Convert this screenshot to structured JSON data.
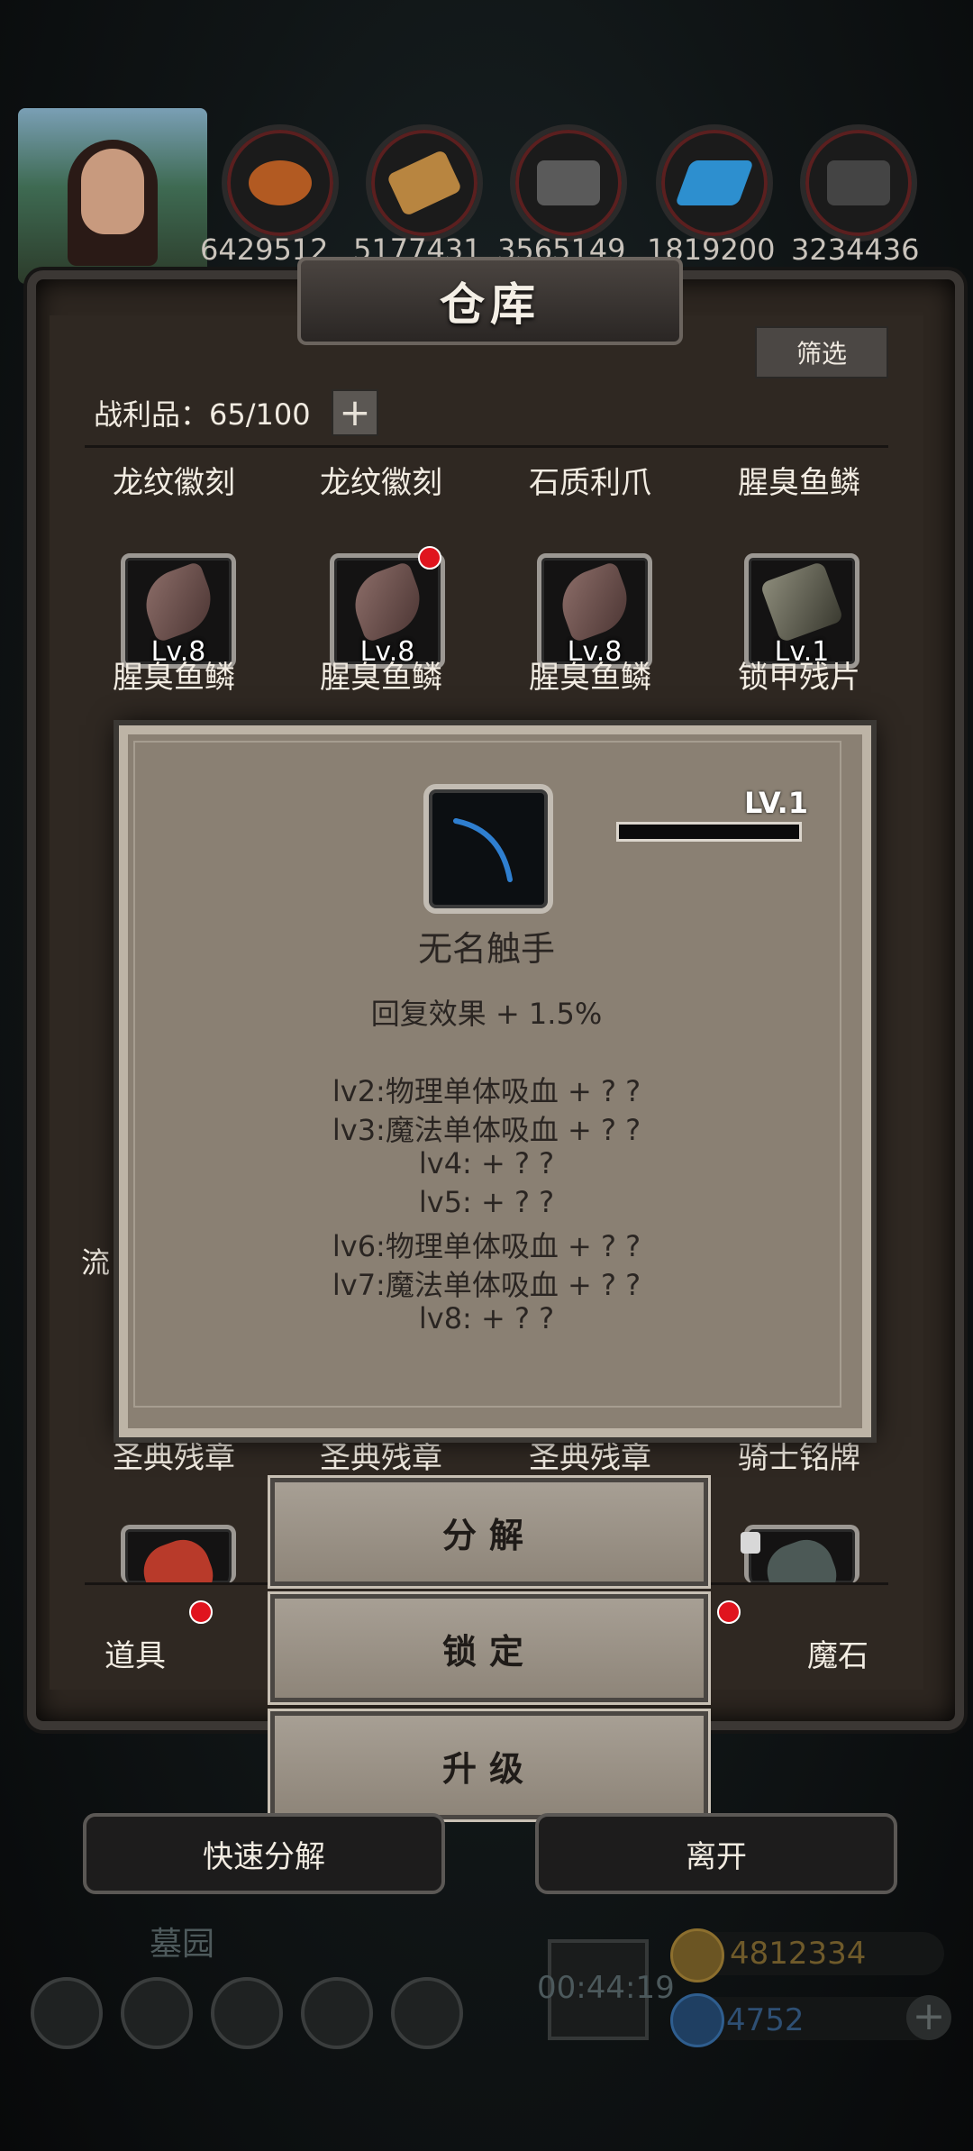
{
  "hud": {
    "resources": [
      "6429512",
      "5177431",
      "3565149",
      "1819200",
      "3234436"
    ],
    "resource_icons": [
      "ore-icon",
      "wood-icon",
      "iron-icon",
      "crystal-icon",
      "steel-icon"
    ]
  },
  "warehouse": {
    "title": "仓库",
    "filter_label": "筛选",
    "loot_count": "战利品：65/100",
    "add_label": "+",
    "row1_labels": [
      "龙纹徽刻",
      "龙纹徽刻",
      "石质利爪",
      "腥臭鱼鳞"
    ],
    "row2": [
      {
        "level": "Lv.8",
        "name": "腥臭鱼鳞"
      },
      {
        "level": "Lv.8",
        "name": "腥臭鱼鳞"
      },
      {
        "level": "Lv.8",
        "name": "腥臭鱼鳞"
      },
      {
        "level": "Lv.1",
        "name": "锁甲残片"
      }
    ],
    "partial_left_label": "流",
    "row_bottom_labels": [
      "圣典残章",
      "圣典残章",
      "圣典残章",
      "骑士铭牌"
    ]
  },
  "popup": {
    "level": "LV.1",
    "level_progress": 0.0,
    "name": "无名触手",
    "effect": "回复效果 + 1.5%",
    "lines": [
      "lv2:物理单体吸血 + ? ?",
      "lv3:魔法单体吸血 + ? ?",
      "lv4: + ? ?",
      "lv5: + ? ?",
      "lv6:物理单体吸血 + ? ?",
      "lv7:魔法单体吸血 + ? ?",
      "lv8: + ? ?"
    ]
  },
  "actions": {
    "decompose": "分解",
    "lock": "锁定",
    "upgrade": "升级"
  },
  "tabs": {
    "items": "道具",
    "magic_stone": "魔石"
  },
  "bottom": {
    "quick_decompose": "快速分解",
    "leave": "离开"
  },
  "footer": {
    "area_name": "墓园",
    "timer": "00:44:19",
    "gold": "4812334",
    "gems": "4752"
  },
  "colors": {
    "accent_red": "#e0141e",
    "panel_bg": "#8a8073",
    "gold": "#a9863c",
    "gem": "#3f6fa5"
  }
}
